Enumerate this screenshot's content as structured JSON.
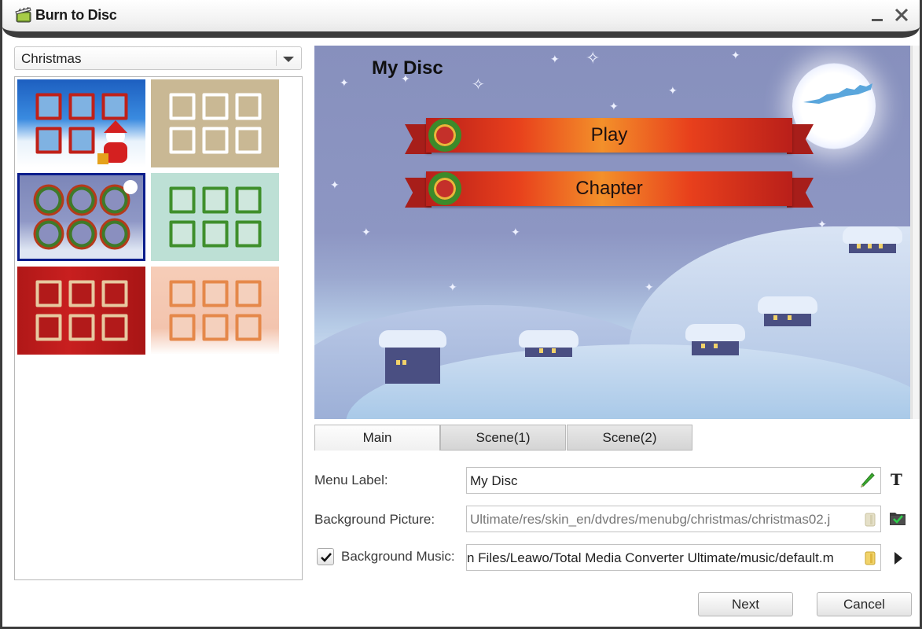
{
  "window": {
    "title": "Burn to Disc",
    "minimize_label": "–",
    "close_label": "✕"
  },
  "theme_selector": {
    "selected": "Christmas",
    "icon": "chevron-down-icon"
  },
  "theme_list": {
    "items": [
      {
        "name": "Christmas template 1",
        "selected": false
      },
      {
        "name": "Christmas template 2",
        "selected": false
      },
      {
        "name": "Christmas template 3",
        "selected": true
      },
      {
        "name": "Christmas template 4",
        "selected": false
      },
      {
        "name": "Christmas template 5",
        "selected": false
      },
      {
        "name": "Christmas template 6",
        "selected": false
      }
    ],
    "selected_border_color": "#0b1e8c"
  },
  "preview": {
    "disc_title": "My Disc",
    "menu_buttons": [
      "Play",
      "Chapter"
    ]
  },
  "tabs": [
    {
      "label": "Main",
      "active": true
    },
    {
      "label": "Scene(1)",
      "active": false
    },
    {
      "label": "Scene(2)",
      "active": false
    }
  ],
  "form": {
    "menu_label": {
      "label": "Menu Label:",
      "value": "My Disc",
      "edit_icon": "pencil-icon",
      "font_icon": "text-font-icon",
      "font_icon_glyph": "T"
    },
    "background_picture": {
      "label": "Background Picture:",
      "value": "Ultimate/res/skin_en/dvdres/menubg/christmas/christmas02.j",
      "browse_icon": "folder-icon",
      "apply_icon": "folder-check-icon"
    },
    "background_music": {
      "label": "Background Music:",
      "checked": true,
      "value": "n Files/Leawo/Total Media Converter Ultimate/music/default.m",
      "browse_icon": "folder-icon",
      "play_icon": "play-icon"
    }
  },
  "buttons": {
    "next": "Next",
    "cancel": "Cancel"
  }
}
